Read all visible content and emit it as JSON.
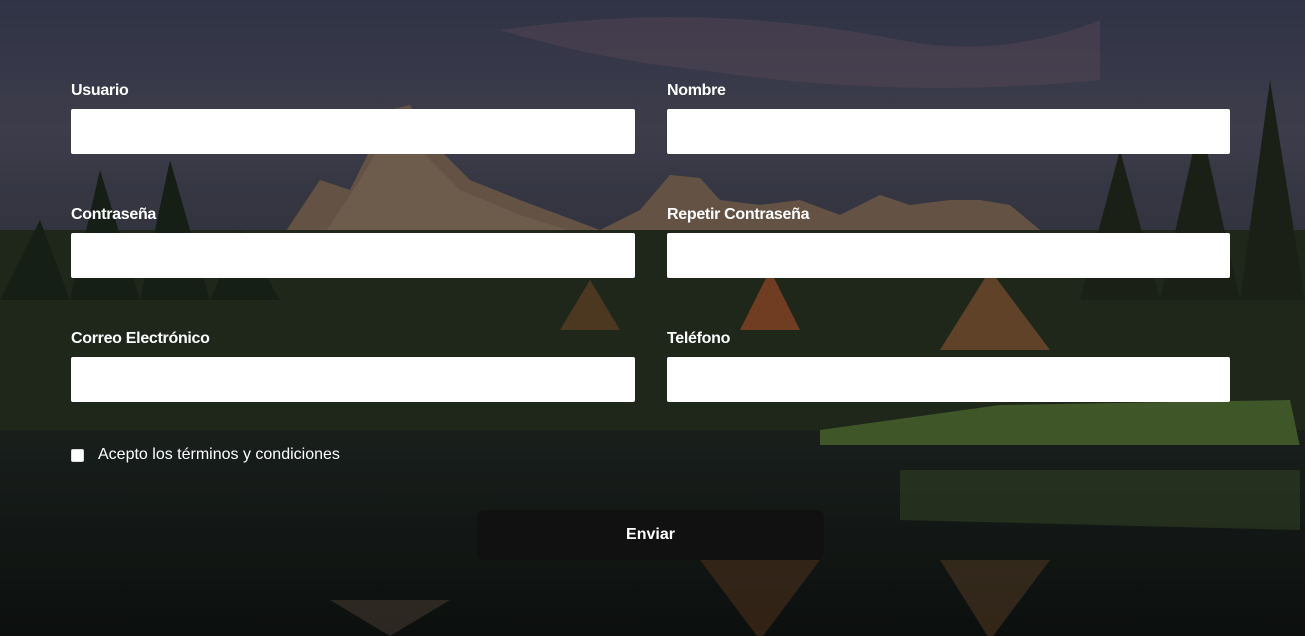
{
  "form": {
    "fields": {
      "usuario": {
        "label": "Usuario",
        "value": "",
        "placeholder": ""
      },
      "nombre": {
        "label": "Nombre",
        "value": "",
        "placeholder": ""
      },
      "contrasena": {
        "label": "Contraseña",
        "value": "",
        "placeholder": ""
      },
      "repetir_contrasena": {
        "label": "Repetir Contraseña",
        "value": "",
        "placeholder": ""
      },
      "correo": {
        "label": "Correo Electrónico",
        "value": "",
        "placeholder": ""
      },
      "telefono": {
        "label": "Teléfono",
        "value": "",
        "placeholder": ""
      }
    },
    "terms_label": "Acepto los términos y condiciones",
    "terms_checked": false,
    "submit_label": "Enviar"
  },
  "colors": {
    "label_text": "#ffffff",
    "input_bg": "#ffffff",
    "button_bg": "#111111",
    "button_text": "#ffffff"
  },
  "background": {
    "icon": "mountain-lake-landscape-image"
  }
}
